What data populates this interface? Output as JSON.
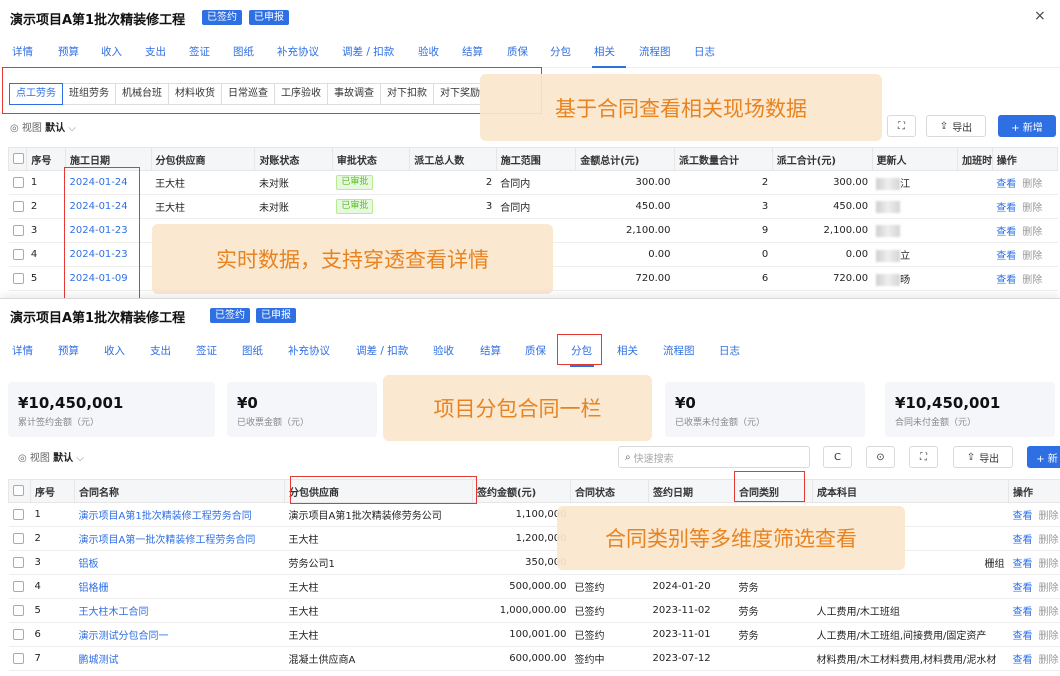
{
  "p1": {
    "title": "演示项目A第1批次精装修工程",
    "badges": [
      "已签约",
      "已申报"
    ],
    "close": "×",
    "tabs": [
      "详情",
      "预算",
      "收入",
      "支出",
      "签证",
      "图纸",
      "补充协议",
      "调差 / 扣款",
      "验收",
      "结算",
      "质保",
      "分包",
      "相关",
      "流程图",
      "日志"
    ],
    "active_tab": "相关",
    "subtabs": [
      "点工劳务",
      "班组劳务",
      "机械台班",
      "材料收货",
      "日常巡查",
      "工序验收",
      "事故调查",
      "对下扣款",
      "对下奖励"
    ],
    "view_prefix": "视图",
    "view_value": "默认",
    "buttons": {
      "expand": "⛶",
      "export": "导出",
      "add": "+ 新增"
    },
    "columns": [
      "序号",
      "施工日期",
      "分包供应商",
      "对账状态",
      "审批状态",
      "派工总人数",
      "施工范围",
      "金额总计(元)",
      "派工数量合计",
      "派工合计(元)",
      "更新人",
      "加班时长",
      "操作"
    ],
    "rows": [
      [
        "1",
        "2024-01-24",
        "王大柱",
        "未对账",
        "已审批",
        "2",
        "合同内",
        "300.00",
        "2",
        "300.00",
        "江"
      ],
      [
        "2",
        "2024-01-24",
        "王大柱",
        "未对账",
        "已审批",
        "3",
        "合同内",
        "450.00",
        "3",
        "450.00",
        ""
      ],
      [
        "3",
        "2024-01-23",
        "",
        "",
        "",
        "",
        "",
        "2,100.00",
        "9",
        "2,100.00",
        ""
      ],
      [
        "4",
        "2024-01-23",
        "",
        "",
        "",
        "",
        "",
        "0.00",
        "0",
        "0.00",
        "立"
      ],
      [
        "5",
        "2024-01-09",
        "",
        "",
        "",
        "",
        "",
        "720.00",
        "6",
        "720.00",
        "旸"
      ]
    ],
    "ops": [
      "查看",
      "删除"
    ],
    "callout_top": "基于合同查看相关现场数据",
    "callout_mid": "实时数据，支持穿透查看详情"
  },
  "p2": {
    "title": "演示项目A第1批次精装修工程",
    "badges": [
      "已签约",
      "已申报"
    ],
    "tabs": [
      "详情",
      "预算",
      "收入",
      "支出",
      "签证",
      "图纸",
      "补充协议",
      "调差 / 扣款",
      "验收",
      "结算",
      "质保",
      "分包",
      "相关",
      "流程图",
      "日志"
    ],
    "active_tab": "分包",
    "cards": [
      {
        "value": "¥10,450,001",
        "label": "累计签约金额（元）"
      },
      {
        "value": "¥0",
        "label": "已收票金额（元）"
      },
      {
        "value": "¥0",
        "label": "已收票未付金额（元）"
      },
      {
        "value": "¥10,450,001",
        "label": "合同未付金额（元）"
      }
    ],
    "view_prefix": "视图",
    "view_value": "默认",
    "search_placeholder": "快速搜索",
    "buttons": {
      "refresh": "C",
      "settings": "⊙",
      "expand": "⛶",
      "export": "导出",
      "add": "+ 新"
    },
    "columns": [
      "序号",
      "合同名称",
      "分包供应商",
      "签约金额(元)",
      "合同状态",
      "签约日期",
      "合同类别",
      "成本科目",
      "操作"
    ],
    "rows": [
      [
        "1",
        "演示项目A第1批次精装修工程劳务合同",
        "演示项目A第1批次精装修劳务公司",
        "1,100,000",
        "",
        "",
        "",
        ""
      ],
      [
        "2",
        "演示项目A第一批次精装修工程劳务合同",
        "王大柱",
        "1,200,000",
        "",
        "",
        "",
        ""
      ],
      [
        "3",
        "铝板",
        "劳务公司1",
        "350,000",
        "",
        "",
        "",
        "栅组"
      ],
      [
        "4",
        "铝格栅",
        "王大柱",
        "500,000.00",
        "已签约",
        "2024-01-20",
        "劳务",
        ""
      ],
      [
        "5",
        "王大柱木工合同",
        "王大柱",
        "1,000,000.00",
        "已签约",
        "2023-11-02",
        "劳务",
        "人工费用/木工班组"
      ],
      [
        "6",
        "演示测试分包合同一",
        "王大柱",
        "100,001.00",
        "已签约",
        "2023-11-01",
        "劳务",
        "人工费用/木工班组,间接费用/固定资产"
      ],
      [
        "7",
        "鹏城测试",
        "混凝土供应商A",
        "600,000.00",
        "签约中",
        "2023-07-12",
        "",
        "材料费用/木工材料费用,材料费用/泥水材"
      ]
    ],
    "ops": [
      "查看",
      "删除"
    ],
    "callout_cards": "项目分包合同一栏",
    "callout_table": "合同类别等多维度筛选查看"
  }
}
